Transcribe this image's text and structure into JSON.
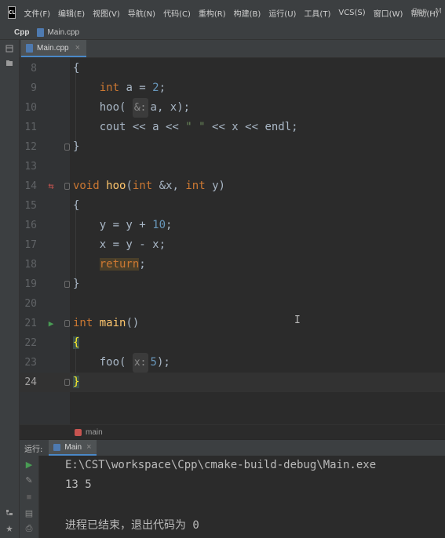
{
  "menubar": {
    "logo": "CL",
    "items": [
      "文件(F)",
      "编辑(E)",
      "视图(V)",
      "导航(N)",
      "代码(C)",
      "重构(R)",
      "构建(B)",
      "运行(U)",
      "工具(T)",
      "VCS(S)",
      "窗口(W)",
      "帮助(H)"
    ],
    "window_title": "Cpp - M"
  },
  "navbar": {
    "project": "Cpp",
    "file": "Main.cpp"
  },
  "editor": {
    "tab_label": "Main.cpp",
    "lines": [
      {
        "number": "8"
      },
      {
        "number": "9",
        "hint": "&:"
      },
      {
        "number": "10"
      },
      {
        "number": "11",
        "str": "\" \""
      },
      {
        "number": "12"
      },
      {
        "number": "13"
      },
      {
        "number": "14"
      },
      {
        "number": "15"
      },
      {
        "number": "16"
      },
      {
        "number": "17"
      },
      {
        "number": "18"
      },
      {
        "number": "19"
      },
      {
        "number": "20"
      },
      {
        "number": "21"
      },
      {
        "number": "22"
      },
      {
        "number": "23",
        "hint": "x:"
      },
      {
        "number": "24"
      }
    ],
    "current_line": "24"
  },
  "breadcrumb": {
    "label": "main"
  },
  "run": {
    "header_label": "运行:",
    "tab_label": "Main",
    "output": [
      "E:\\CST\\workspace\\Cpp\\cmake-build-debug\\Main.exe",
      "13 5",
      "",
      "进程已结束，退出代码为 0"
    ]
  },
  "colors": {
    "background": "#2b2b2b",
    "keyword": "#cc7832",
    "number": "#6897bb",
    "string": "#6a8759",
    "function": "#ffc66d",
    "text": "#a9b7c6",
    "run_green": "#499c54"
  }
}
